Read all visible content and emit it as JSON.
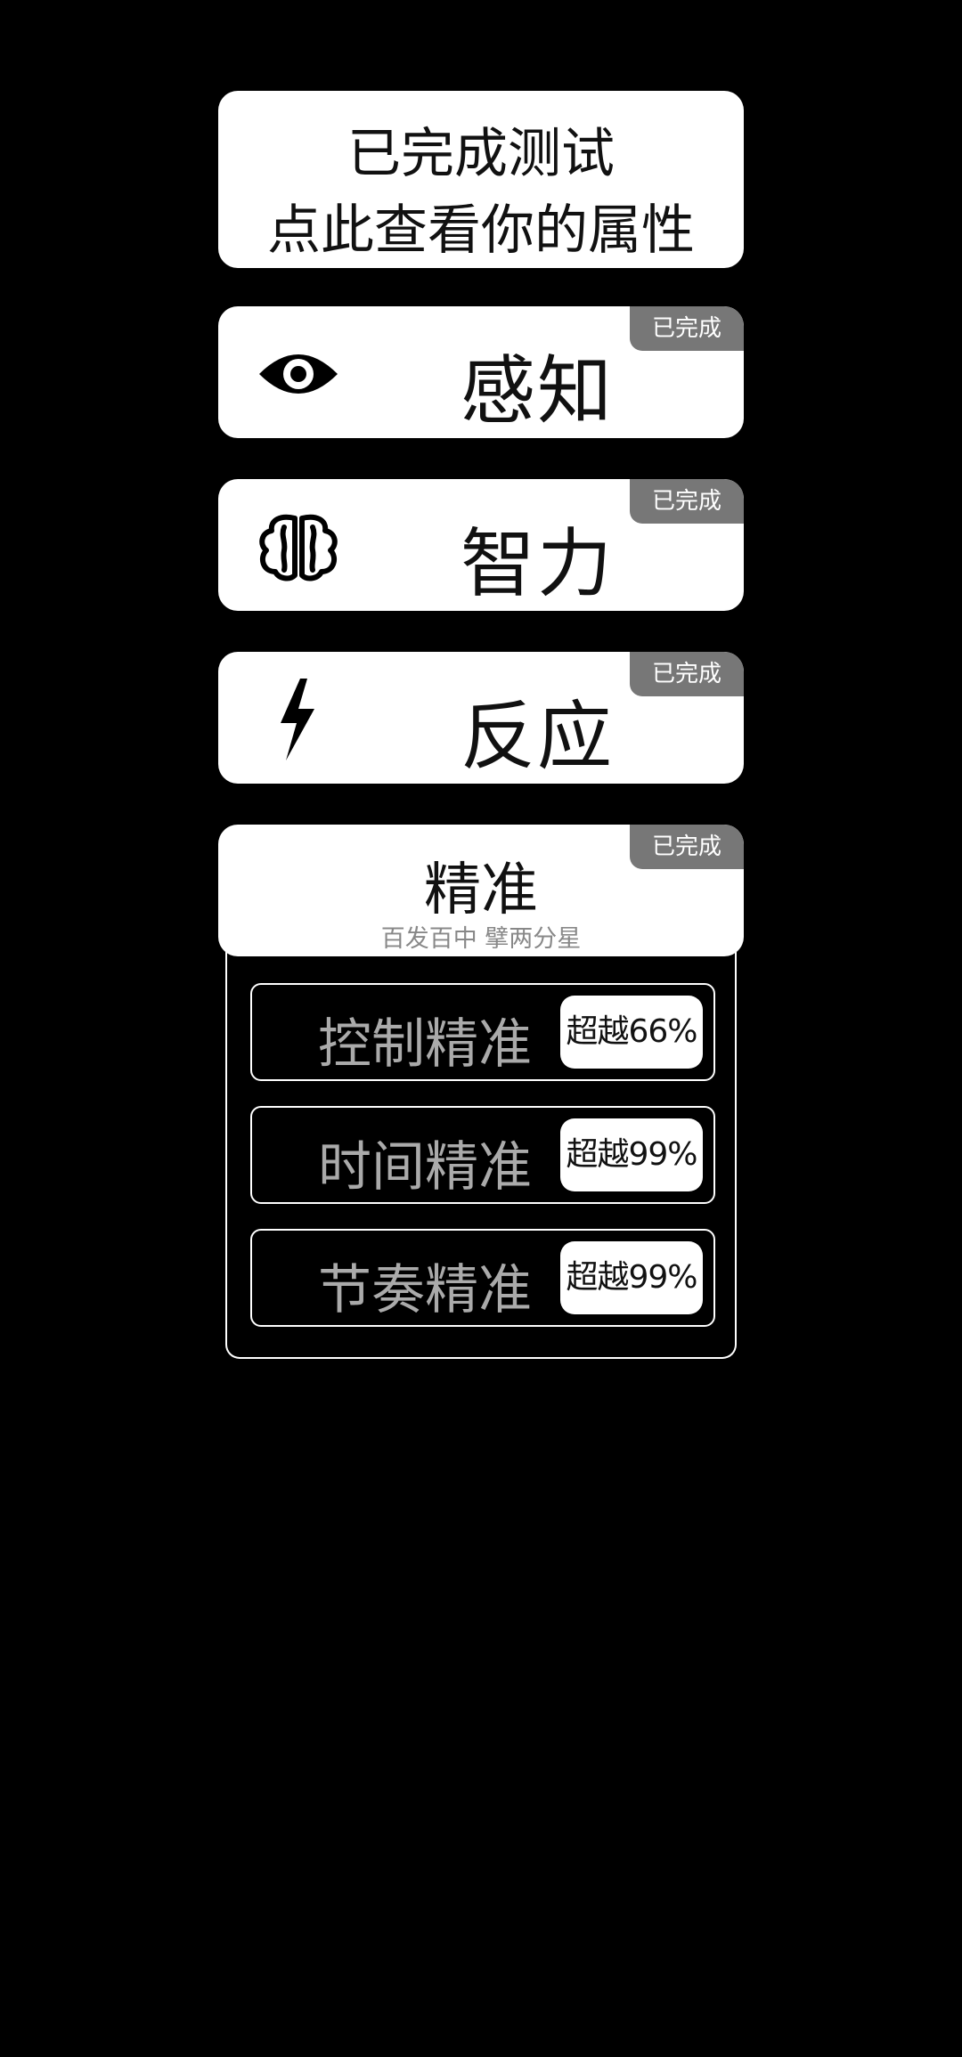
{
  "summary": {
    "line1": "已完成测试",
    "line2": "点此查看你的属性"
  },
  "categories": [
    {
      "name": "感知",
      "icon": "eye-icon",
      "badge": "已完成"
    },
    {
      "name": "智力",
      "icon": "brain-icon",
      "badge": "已完成"
    },
    {
      "name": "反应",
      "icon": "lightning-icon",
      "badge": "已完成"
    }
  ],
  "accuracy": {
    "title": "精准",
    "subtitle": "百发百中 擘两分星",
    "badge": "已完成",
    "items": [
      {
        "label": "控制精准",
        "result": "超越66%"
      },
      {
        "label": "时间精准",
        "result": "超越99%"
      },
      {
        "label": "节奏精准",
        "result": "超越99%"
      }
    ]
  }
}
